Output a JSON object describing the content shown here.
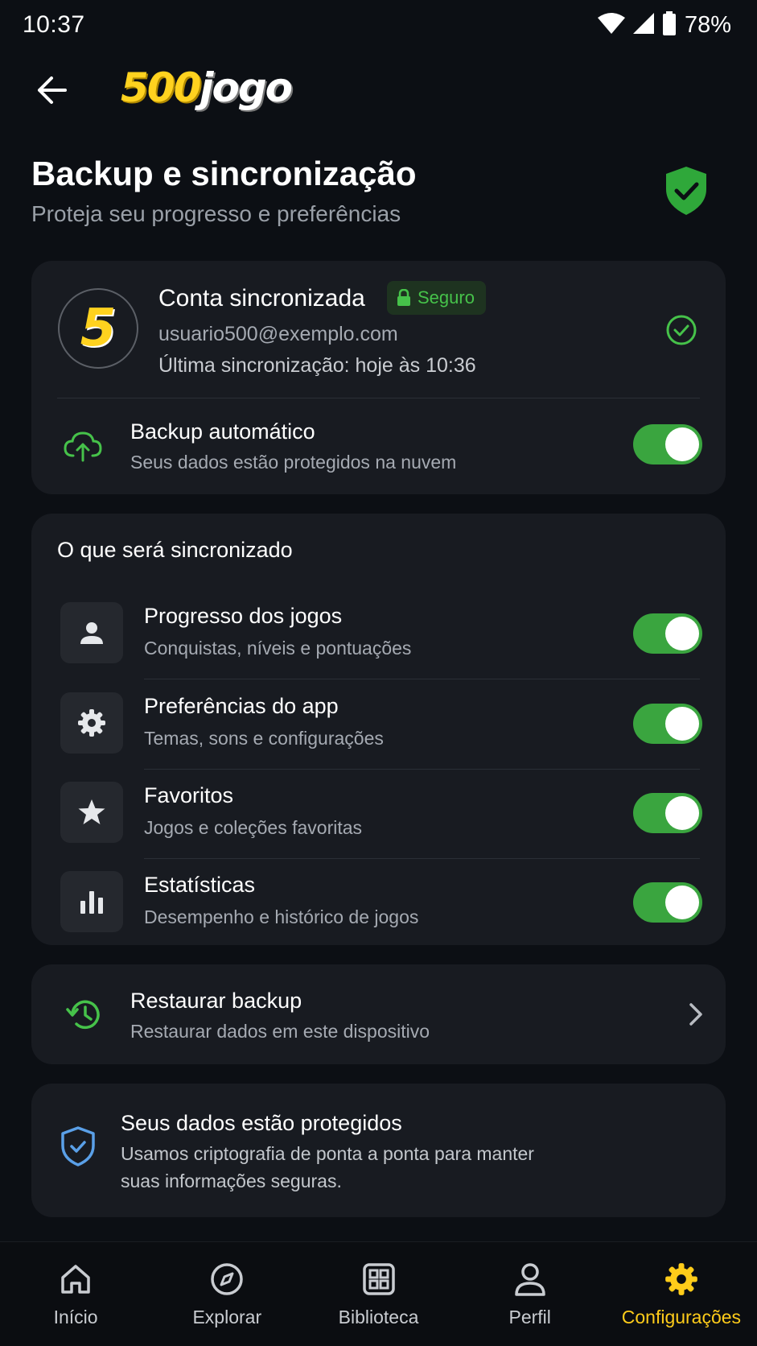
{
  "status_bar": {
    "time": "10:37",
    "battery": "78%"
  },
  "header": {
    "logo_number": "500",
    "logo_word": "jogo"
  },
  "page": {
    "title": "Backup e sincronização",
    "subtitle": "Proteja seu progresso e preferências"
  },
  "account": {
    "avatar_letter": "5",
    "name": "Conta sincronizada",
    "badge": "Seguro",
    "email": "usuario500@exemplo.com",
    "last_sync": "Última sincronização: hoje às 10:36"
  },
  "auto_backup": {
    "title": "Backup automático",
    "subtitle": "Seus dados estão protegidos na nuvem",
    "enabled": true
  },
  "sync_section": {
    "heading": "O que será sincronizado",
    "items": [
      {
        "title": "Progresso dos jogos",
        "subtitle": "Conquistas, níveis e pontuações",
        "icon": "person-icon",
        "enabled": true
      },
      {
        "title": "Preferências do app",
        "subtitle": "Temas, sons e configurações",
        "icon": "gear-icon",
        "enabled": true
      },
      {
        "title": "Favoritos",
        "subtitle": "Jogos e coleções favoritas",
        "icon": "star-icon",
        "enabled": true
      },
      {
        "title": "Estatísticas",
        "subtitle": "Desempenho e histórico de jogos",
        "icon": "bar-chart-icon",
        "enabled": true
      }
    ]
  },
  "restore": {
    "title": "Restaurar backup",
    "subtitle": "Restaurar dados em este dispositivo"
  },
  "protected": {
    "title": "Seus dados estão protegidos",
    "line1": "Usamos criptografia de ponta a ponta para manter",
    "line2": "suas informações seguras."
  },
  "bottom_nav": [
    {
      "label": "Início",
      "icon": "home-icon",
      "active": false
    },
    {
      "label": "Explorar",
      "icon": "compass-icon",
      "active": false
    },
    {
      "label": "Biblioteca",
      "icon": "library-icon",
      "active": false
    },
    {
      "label": "Perfil",
      "icon": "profile-icon",
      "active": false
    },
    {
      "label": "Configurações",
      "icon": "settings-icon",
      "active": true
    }
  ],
  "colors": {
    "accent_yellow": "#ffcc1a",
    "toggle_green": "#3aa53f",
    "secure_green": "#46c24a",
    "card_bg": "#181b21",
    "page_bg": "#0c0f14"
  }
}
